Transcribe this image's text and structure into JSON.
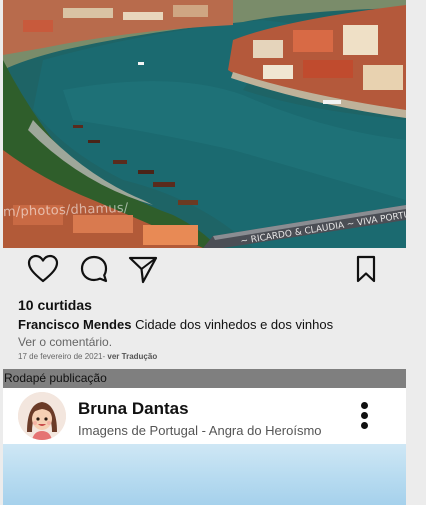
{
  "post": {
    "image": {
      "alt": "Cidade dos vinhedos e dos vinhos",
      "watermark": "m/photos/dhamus/"
    },
    "actions": {
      "like_icon": "heart-icon",
      "comment_icon": "comment-icon",
      "share_icon": "send-icon",
      "save_icon": "bookmark-icon"
    },
    "likes_text": "10 curtidas",
    "author": "Francisco Mendes",
    "caption": "Cidade dos vinhedos e dos vinhos",
    "see_comments": "Ver o comentário.",
    "date": "17 de fevereiro de 2021",
    "date_sep": "- ",
    "translation": "ver Tradução"
  },
  "footer_label": "Rodapé publicação",
  "next_post": {
    "user_name": "Bruna Dantas",
    "location": "Imagens de Portugal - Angra do Heroísmo",
    "menu_icon": "more-vertical-icon"
  },
  "colors": {
    "background": "#ececec",
    "footer_bar": "#7f7f7f",
    "header_bg": "#ffffff"
  }
}
